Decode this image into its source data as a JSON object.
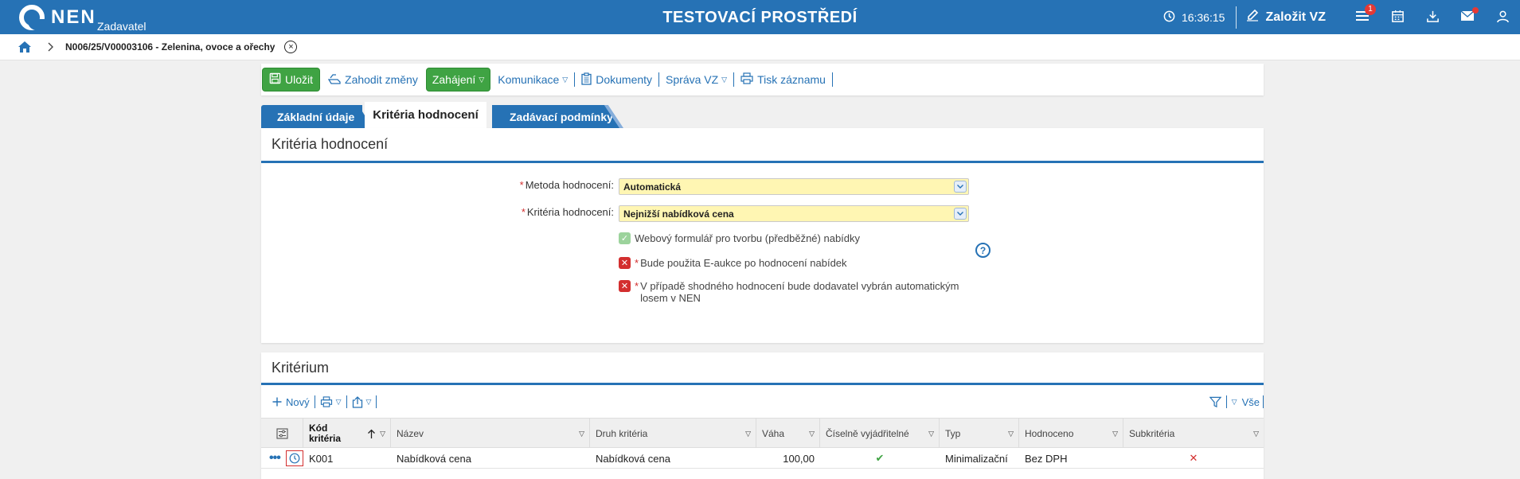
{
  "header": {
    "logo_text": "NEN",
    "logo_sub": "Zadavatel",
    "title": "TESTOVACÍ PROSTŘEDÍ",
    "clock": "16:36:15",
    "new_vz_label": "Založit VZ",
    "menu_badge": "1"
  },
  "breadcrumb": {
    "text": "N006/25/V00003106 - Zelenina, ovoce a ořechy"
  },
  "toolbar": {
    "save": "Uložit",
    "discard": "Zahodit změny",
    "start": "Zahájení",
    "communication": "Komunikace",
    "documents": "Dokumenty",
    "management": "Správa VZ",
    "print": "Tisk záznamu"
  },
  "tabs": {
    "basic": "Základní údaje",
    "criteria": "Kritéria hodnocení",
    "conditions": "Zadávací podmínky"
  },
  "section_criteria": {
    "title": "Kritéria hodnocení",
    "method_label": "Metoda hodnocení:",
    "method_value": "Automatická",
    "criteria_label": "Kritéria hodnocení:",
    "criteria_value": "Nejnižší nabídková cena",
    "webform_label": "Webový formulář pro tvorbu (předběžné) nabídky",
    "eauction_label": "Bude použita E-aukce po hodnocení nabídek",
    "lottery_label_1": "V případě shodného hodnocení bude dodavatel vybrán automatickým",
    "lottery_label_2": "losem v NEN"
  },
  "section_kriterium": {
    "title": "Kritérium",
    "new_label": "Nový",
    "all_label": "Vše",
    "columns": {
      "code_1": "Kód",
      "code_2": "kritéria",
      "name": "Název",
      "kind": "Druh kritéria",
      "weight": "Váha",
      "numeric": "Číselně vyjádřitelné",
      "type": "Typ",
      "evaluated": "Hodnoceno",
      "sub": "Subkritéria"
    },
    "rows": [
      {
        "code": "K001",
        "name": "Nabídková cena",
        "kind": "Nabídková cena",
        "weight": "100,00",
        "type": "Minimalizační",
        "evaluated": "Bez DPH"
      }
    ]
  }
}
